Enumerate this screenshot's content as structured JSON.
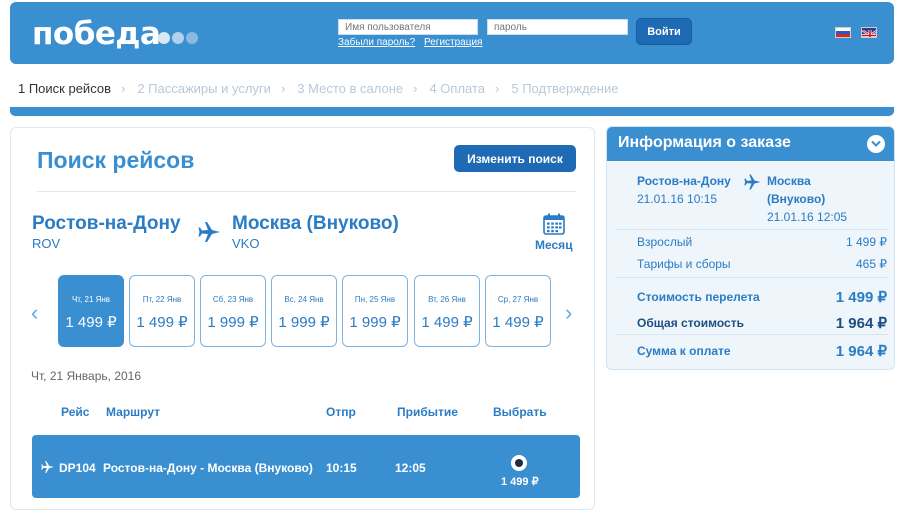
{
  "header": {
    "logo": "победа",
    "username_placeholder": "Имя пользователя",
    "password_placeholder": "пароль",
    "forgot_link": "Забыли пароль?",
    "register_link": "Регистрация",
    "login_button": "Войти",
    "colors": {
      "bar": "#3a8fd0",
      "button": "#1f6ab4"
    }
  },
  "steps": [
    {
      "label": "1 Поиск рейсов",
      "active": true
    },
    {
      "label": "2 Пассажиры и услуги",
      "active": false
    },
    {
      "label": "3 Место в салоне",
      "active": false
    },
    {
      "label": "4 Оплата",
      "active": false
    },
    {
      "label": "5 Подтверждение",
      "active": false
    }
  ],
  "search": {
    "title": "Поиск рейсов",
    "change_button": "Изменить поиск",
    "origin_city": "Ростов-на-Дону",
    "origin_code": "ROV",
    "dest_city": "Москва (Внуково)",
    "dest_code": "VKO",
    "month_label": "Месяц",
    "dates": [
      {
        "day": "Чт, 21 Янв",
        "price": "1 499 ₽",
        "selected": true
      },
      {
        "day": "Пт, 22 Янв",
        "price": "1 499 ₽",
        "selected": false
      },
      {
        "day": "Сб, 23 Янв",
        "price": "1 999 ₽",
        "selected": false
      },
      {
        "day": "Вс, 24 Янв",
        "price": "1 999 ₽",
        "selected": false
      },
      {
        "day": "Пн, 25 Янв",
        "price": "1 999 ₽",
        "selected": false
      },
      {
        "day": "Вт, 26 Янв",
        "price": "1 499 ₽",
        "selected": false
      },
      {
        "day": "Ср, 27 Янв",
        "price": "1 499 ₽",
        "selected": false
      }
    ],
    "selected_date_text": "Чт, 21 Январь, 2016",
    "columns": {
      "flight": "Рейс",
      "route": "Маршрут",
      "depart": "Отпр",
      "arrive": "Прибытие",
      "choose": "Выбрать"
    },
    "flights": [
      {
        "number": "DP104",
        "route": "Ростов-на-Дону - Москва (Внуково)",
        "depart": "10:15",
        "arrive": "12:05",
        "price": "1 499 ₽"
      }
    ]
  },
  "order": {
    "title": "Информация о заказе",
    "origin": "Ростов-на-Дону",
    "origin_datetime": "21.01.16 10:15",
    "dest_line1": "Москва",
    "dest_line2": "(Внуково)",
    "dest_datetime": "21.01.16 12:05",
    "adult_label": "Взрослый",
    "adult_price": "1 499 ₽",
    "fees_label": "Тарифы и сборы",
    "fees_price": "465 ₽",
    "flight_cost_label": "Стоимость перелета",
    "flight_cost": "1 499 ₽",
    "total_label": "Общая стоимость",
    "total": "1 964 ₽",
    "pay_label": "Сумма к оплате",
    "pay": "1 964 ₽"
  }
}
